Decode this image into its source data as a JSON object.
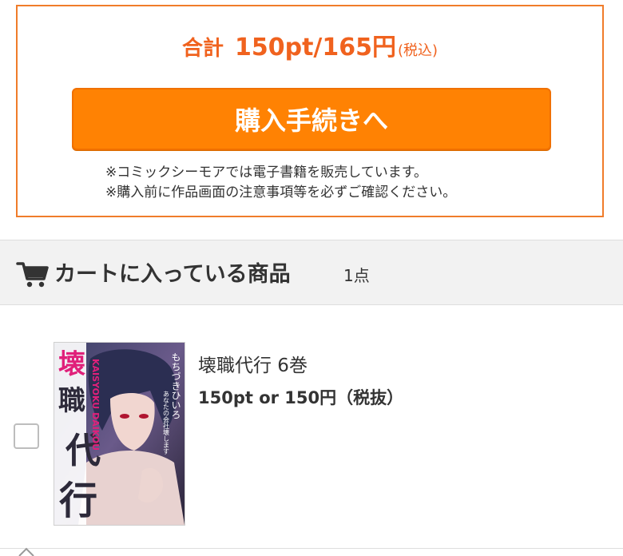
{
  "summary": {
    "total_label": "合計",
    "total_value": "150pt/165円",
    "tax_note": "(税込)",
    "checkout_label": "購入手続きへ",
    "notes": [
      "※コミックシーモアでは電子書籍を販売しています。",
      "※購入前に作品画面の注意事項等を必ずご確認ください。"
    ]
  },
  "cart": {
    "icon": "cart-icon",
    "title": "カートに入っている商品",
    "count": "1点"
  },
  "items": [
    {
      "title": "壊職代行 6巻",
      "price": "150pt or 150円（税抜）",
      "cover": {
        "title_kanji": [
          "壊",
          "職",
          "代",
          "行"
        ],
        "title_romaji": "KAISYOKU DAIKOU",
        "author": "もちづきひいろ",
        "blurb": "あなたの会社壊します"
      }
    }
  ],
  "colors": {
    "accent": "#ff8203",
    "accent_text": "#f0621e",
    "cover_title": "#e0207a"
  }
}
